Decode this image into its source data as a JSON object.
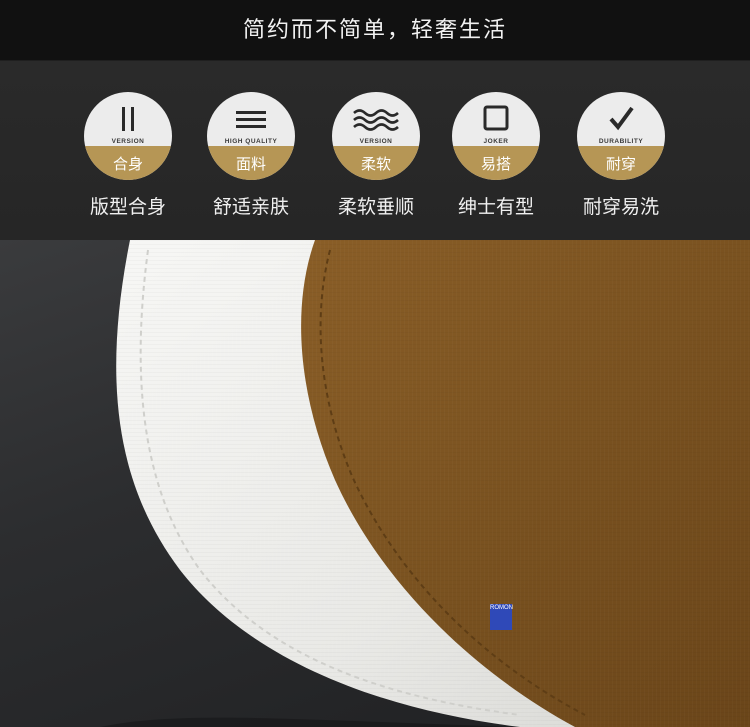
{
  "header": {
    "slogan": "简约而不简单，轻奢生活"
  },
  "features": [
    {
      "icon": "two-bars-icon",
      "badge_en": "VERSION",
      "badge_cn": "合身",
      "label": "版型合身"
    },
    {
      "icon": "three-lines-icon",
      "badge_en": "HIGH QUALITY",
      "badge_cn": "面料",
      "label": "舒适亲肤"
    },
    {
      "icon": "waves-icon",
      "badge_en": "VERSION",
      "badge_cn": "柔软",
      "label": "柔软垂顺"
    },
    {
      "icon": "square-icon",
      "badge_en": "JOKER",
      "badge_cn": "易搭",
      "label": "绅士有型"
    },
    {
      "icon": "checkmark-icon",
      "badge_en": "DURABILITY",
      "badge_cn": "耐穿",
      "label": "耐穿易洗"
    }
  ],
  "colors": {
    "gold": "#b69655",
    "badge_bg": "#ececec",
    "brown_fabric": "#7a5220",
    "white_fabric": "#f4f4f2"
  },
  "photo": {
    "subject": "fabric-close-up",
    "brand_logo": "ROMON"
  }
}
